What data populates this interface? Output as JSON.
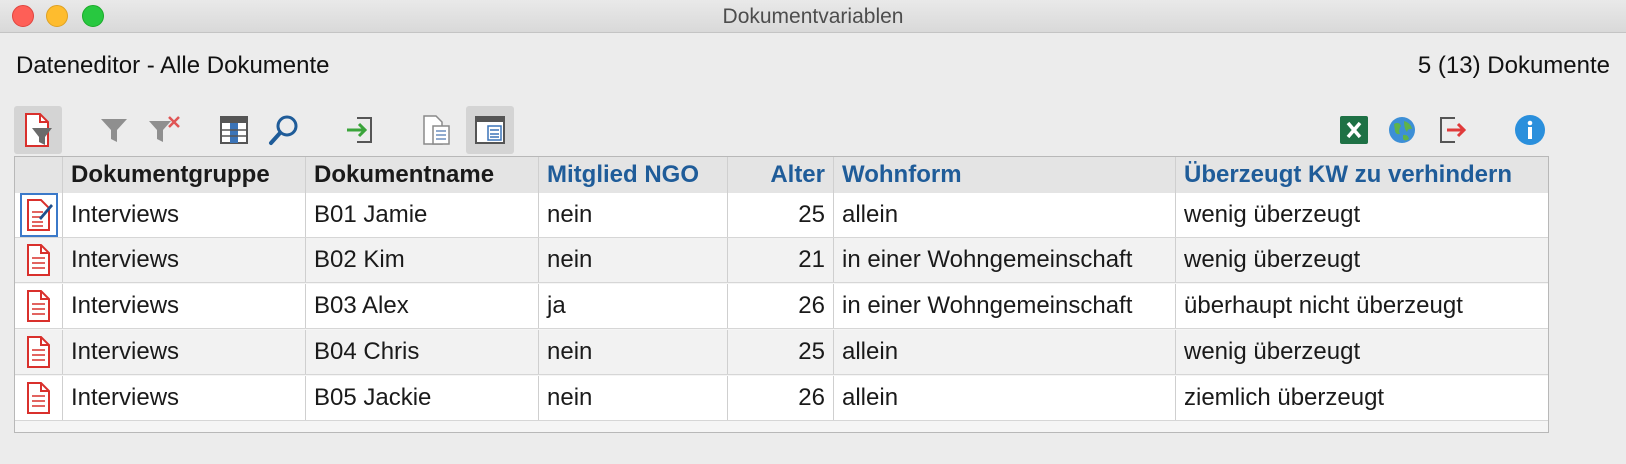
{
  "window": {
    "title": "Dokumentvariablen"
  },
  "header": {
    "editor_title": "Dateneditor - Alle Dokumente",
    "doc_count": "5 (13) Dokumente"
  },
  "toolbar": {
    "icons": [
      "filter-documents-icon",
      "filter-icon",
      "remove-filter-icon",
      "columns-icon",
      "search-icon",
      "import-icon",
      "list-view-icon",
      "document-preview-icon",
      "excel-icon",
      "globe-icon",
      "export-icon",
      "info-icon"
    ]
  },
  "table": {
    "columns": [
      "Dokumentgruppe",
      "Dokumentname",
      "Mitglied NGO",
      "Alter",
      "Wohnform",
      "Überzeugt KW zu verhindern"
    ],
    "rows": [
      {
        "group": "Interviews",
        "name": "B01 Jamie",
        "ngo": "nein",
        "age": "25",
        "living": "allein",
        "convinced": "wenig überzeugt"
      },
      {
        "group": "Interviews",
        "name": "B02 Kim",
        "ngo": "nein",
        "age": "21",
        "living": "in einer Wohngemeinschaft",
        "convinced": "wenig überzeugt"
      },
      {
        "group": "Interviews",
        "name": "B03 Alex",
        "ngo": "ja",
        "age": "26",
        "living": "in einer Wohngemeinschaft",
        "convinced": "überhaupt nicht überzeugt"
      },
      {
        "group": "Interviews",
        "name": "B04 Chris",
        "ngo": "nein",
        "age": "25",
        "living": "allein",
        "convinced": "wenig überzeugt"
      },
      {
        "group": "Interviews",
        "name": "B05 Jackie",
        "ngo": "nein",
        "age": "26",
        "living": "allein",
        "convinced": "ziemlich überzeugt"
      }
    ]
  },
  "colors": {
    "header_blue": "#1f5c99",
    "doc_icon_red": "#d9302c",
    "excel_green": "#1e7145",
    "info_blue": "#2a8fdc"
  }
}
